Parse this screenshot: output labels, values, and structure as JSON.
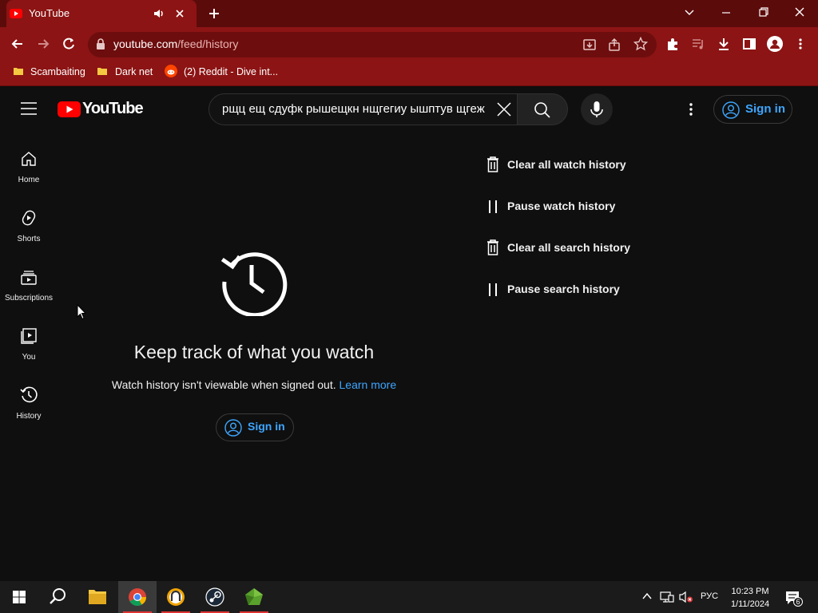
{
  "browser": {
    "tab_title": "YouTube",
    "url_domain": "youtube.com",
    "url_path": "/feed/history",
    "bookmarks": [
      {
        "label": "Scambaiting",
        "icon": "folder-icon"
      },
      {
        "label": "Dark net",
        "icon": "folder-icon"
      },
      {
        "label": "(2) Reddit - Dive int...",
        "icon": "reddit-icon"
      }
    ],
    "colors": {
      "frame": "#5c0b0b",
      "toolbar": "#8c1414"
    }
  },
  "youtube": {
    "logo_text": "YouTube",
    "search_value": "рщц ещ сдуфк рышещкн нщгегиу ышптув щгеж",
    "sign_in_label": "Sign in",
    "sidebar": [
      {
        "label": "Home",
        "icon": "home-icon"
      },
      {
        "label": "Shorts",
        "icon": "shorts-icon"
      },
      {
        "label": "Subscriptions",
        "icon": "subscriptions-icon"
      },
      {
        "label": "You",
        "icon": "you-icon"
      },
      {
        "label": "History",
        "icon": "history-icon"
      }
    ],
    "empty_state": {
      "title": "Keep track of what you watch",
      "description": "Watch history isn't viewable when signed out.",
      "learn_more": "Learn more",
      "sign_in_label": "Sign in"
    },
    "actions": [
      {
        "label": "Clear all watch history",
        "icon": "trash-icon"
      },
      {
        "label": "Pause watch history",
        "icon": "pause-icon"
      },
      {
        "label": "Clear all search history",
        "icon": "trash-icon"
      },
      {
        "label": "Pause search history",
        "icon": "pause-icon"
      }
    ],
    "colors": {
      "brand_red": "#ff0000",
      "link": "#3ea6ff",
      "background": "#0f0f0f"
    }
  },
  "taskbar": {
    "language": "РУС",
    "time": "10:23 PM",
    "date": "1/11/2024",
    "notification_count": "6"
  }
}
